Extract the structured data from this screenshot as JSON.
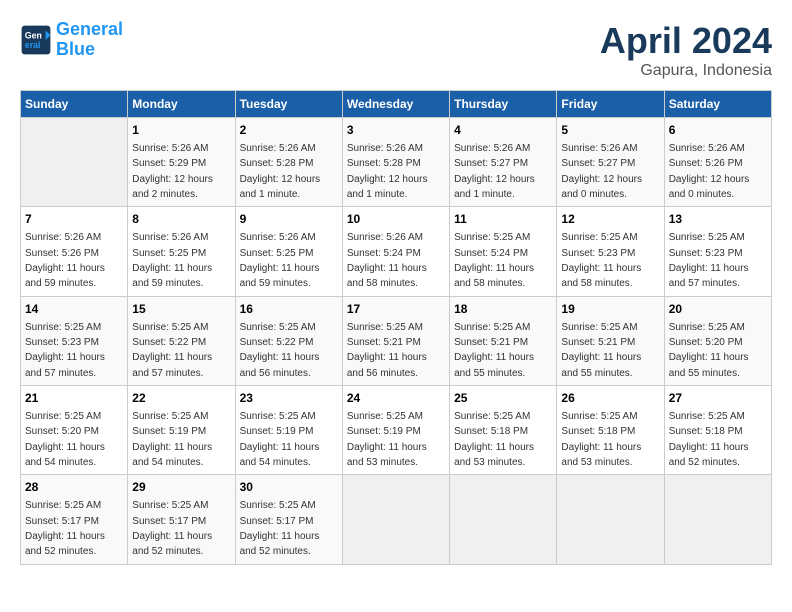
{
  "header": {
    "logo_line1": "General",
    "logo_line2": "Blue",
    "month": "April 2024",
    "location": "Gapura, Indonesia"
  },
  "days_of_week": [
    "Sunday",
    "Monday",
    "Tuesday",
    "Wednesday",
    "Thursday",
    "Friday",
    "Saturday"
  ],
  "weeks": [
    [
      {
        "day": "",
        "empty": true
      },
      {
        "day": "1",
        "sunrise": "5:26 AM",
        "sunset": "5:29 PM",
        "daylight": "12 hours and 2 minutes."
      },
      {
        "day": "2",
        "sunrise": "5:26 AM",
        "sunset": "5:28 PM",
        "daylight": "12 hours and 1 minute."
      },
      {
        "day": "3",
        "sunrise": "5:26 AM",
        "sunset": "5:28 PM",
        "daylight": "12 hours and 1 minute."
      },
      {
        "day": "4",
        "sunrise": "5:26 AM",
        "sunset": "5:27 PM",
        "daylight": "12 hours and 1 minute."
      },
      {
        "day": "5",
        "sunrise": "5:26 AM",
        "sunset": "5:27 PM",
        "daylight": "12 hours and 0 minutes."
      },
      {
        "day": "6",
        "sunrise": "5:26 AM",
        "sunset": "5:26 PM",
        "daylight": "12 hours and 0 minutes."
      }
    ],
    [
      {
        "day": "7",
        "sunrise": "5:26 AM",
        "sunset": "5:26 PM",
        "daylight": "11 hours and 59 minutes."
      },
      {
        "day": "8",
        "sunrise": "5:26 AM",
        "sunset": "5:25 PM",
        "daylight": "11 hours and 59 minutes."
      },
      {
        "day": "9",
        "sunrise": "5:26 AM",
        "sunset": "5:25 PM",
        "daylight": "11 hours and 59 minutes."
      },
      {
        "day": "10",
        "sunrise": "5:26 AM",
        "sunset": "5:24 PM",
        "daylight": "11 hours and 58 minutes."
      },
      {
        "day": "11",
        "sunrise": "5:25 AM",
        "sunset": "5:24 PM",
        "daylight": "11 hours and 58 minutes."
      },
      {
        "day": "12",
        "sunrise": "5:25 AM",
        "sunset": "5:23 PM",
        "daylight": "11 hours and 58 minutes."
      },
      {
        "day": "13",
        "sunrise": "5:25 AM",
        "sunset": "5:23 PM",
        "daylight": "11 hours and 57 minutes."
      }
    ],
    [
      {
        "day": "14",
        "sunrise": "5:25 AM",
        "sunset": "5:23 PM",
        "daylight": "11 hours and 57 minutes."
      },
      {
        "day": "15",
        "sunrise": "5:25 AM",
        "sunset": "5:22 PM",
        "daylight": "11 hours and 57 minutes."
      },
      {
        "day": "16",
        "sunrise": "5:25 AM",
        "sunset": "5:22 PM",
        "daylight": "11 hours and 56 minutes."
      },
      {
        "day": "17",
        "sunrise": "5:25 AM",
        "sunset": "5:21 PM",
        "daylight": "11 hours and 56 minutes."
      },
      {
        "day": "18",
        "sunrise": "5:25 AM",
        "sunset": "5:21 PM",
        "daylight": "11 hours and 55 minutes."
      },
      {
        "day": "19",
        "sunrise": "5:25 AM",
        "sunset": "5:21 PM",
        "daylight": "11 hours and 55 minutes."
      },
      {
        "day": "20",
        "sunrise": "5:25 AM",
        "sunset": "5:20 PM",
        "daylight": "11 hours and 55 minutes."
      }
    ],
    [
      {
        "day": "21",
        "sunrise": "5:25 AM",
        "sunset": "5:20 PM",
        "daylight": "11 hours and 54 minutes."
      },
      {
        "day": "22",
        "sunrise": "5:25 AM",
        "sunset": "5:19 PM",
        "daylight": "11 hours and 54 minutes."
      },
      {
        "day": "23",
        "sunrise": "5:25 AM",
        "sunset": "5:19 PM",
        "daylight": "11 hours and 54 minutes."
      },
      {
        "day": "24",
        "sunrise": "5:25 AM",
        "sunset": "5:19 PM",
        "daylight": "11 hours and 53 minutes."
      },
      {
        "day": "25",
        "sunrise": "5:25 AM",
        "sunset": "5:18 PM",
        "daylight": "11 hours and 53 minutes."
      },
      {
        "day": "26",
        "sunrise": "5:25 AM",
        "sunset": "5:18 PM",
        "daylight": "11 hours and 53 minutes."
      },
      {
        "day": "27",
        "sunrise": "5:25 AM",
        "sunset": "5:18 PM",
        "daylight": "11 hours and 52 minutes."
      }
    ],
    [
      {
        "day": "28",
        "sunrise": "5:25 AM",
        "sunset": "5:17 PM",
        "daylight": "11 hours and 52 minutes."
      },
      {
        "day": "29",
        "sunrise": "5:25 AM",
        "sunset": "5:17 PM",
        "daylight": "11 hours and 52 minutes."
      },
      {
        "day": "30",
        "sunrise": "5:25 AM",
        "sunset": "5:17 PM",
        "daylight": "11 hours and 52 minutes."
      },
      {
        "day": "",
        "empty": true
      },
      {
        "day": "",
        "empty": true
      },
      {
        "day": "",
        "empty": true
      },
      {
        "day": "",
        "empty": true
      }
    ]
  ],
  "labels": {
    "sunrise": "Sunrise:",
    "sunset": "Sunset:",
    "daylight": "Daylight:"
  }
}
